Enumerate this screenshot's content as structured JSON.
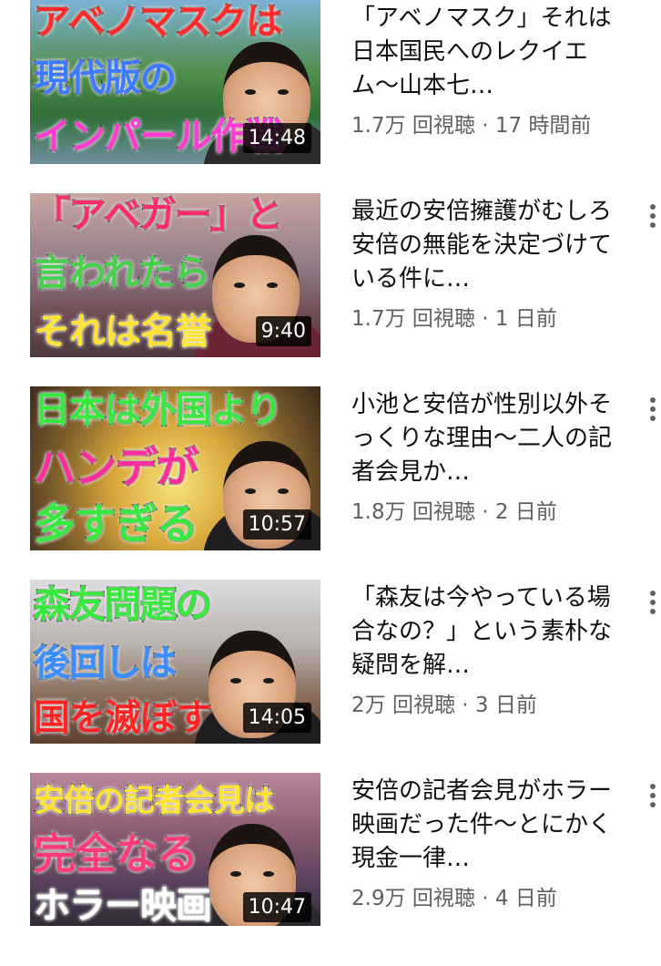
{
  "videos": [
    {
      "title": "「アベノマスク」それは日本国民へのレクイエム〜山本七…",
      "views": "1.7万 回視聴",
      "age": "17 時間前",
      "duration": "14:48",
      "caption_lines": [
        "アベノマスクは",
        "現代版の",
        "インパール作戦"
      ]
    },
    {
      "title": "最近の安倍擁護がむしろ安倍の無能を決定づけている件に…",
      "views": "1.7万 回視聴",
      "age": "1 日前",
      "duration": "9:40",
      "caption_lines": [
        "「アベガー」と",
        "言われたら",
        "それは名誉"
      ]
    },
    {
      "title": "小池と安倍が性別以外そっくりな理由〜二人の記者会見か…",
      "views": "1.8万 回視聴",
      "age": "2 日前",
      "duration": "10:57",
      "caption_lines": [
        "日本は外国より",
        "ハンデが",
        "多すぎる"
      ]
    },
    {
      "title": "「森友は今やっている場合なの？」という素朴な疑問を解…",
      "views": "2万 回視聴",
      "age": "3 日前",
      "duration": "14:05",
      "caption_lines": [
        "森友問題の",
        "後回しは",
        "国を滅ぼす"
      ]
    },
    {
      "title": "安倍の記者会見がホラー映画だった件〜とにかく現金一律…",
      "views": "2.9万 回視聴",
      "age": "4 日前",
      "duration": "10:47",
      "caption_lines": [
        "安倍の記者会見は",
        "完全なる",
        "ホラー映画"
      ]
    }
  ],
  "meta_separator": " · ",
  "more_icon": "more-vert-icon"
}
